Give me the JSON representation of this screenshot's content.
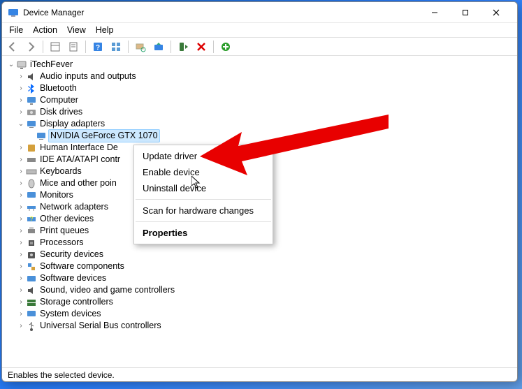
{
  "window": {
    "title": "Device Manager"
  },
  "menu": {
    "file": "File",
    "action": "Action",
    "view": "View",
    "help": "Help"
  },
  "tree": {
    "root": "iTechFever",
    "items": {
      "audio": "Audio inputs and outputs",
      "bluetooth": "Bluetooth",
      "computer": "Computer",
      "disk": "Disk drives",
      "display": "Display adapters",
      "display_child": "NVIDIA GeForce GTX 1070",
      "hid": "Human Interface De",
      "ide": "IDE ATA/ATAPI contr",
      "keyboards": "Keyboards",
      "mice": "Mice and other poin",
      "monitors": "Monitors",
      "network": "Network adapters",
      "other": "Other devices",
      "printq": "Print queues",
      "cpu": "Processors",
      "secdev": "Security devices",
      "swcomp": "Software components",
      "swdev": "Software devices",
      "sound": "Sound, video and game controllers",
      "storage": "Storage controllers",
      "sysdev": "System devices",
      "usb": "Universal Serial Bus controllers"
    }
  },
  "context": {
    "update": "Update driver",
    "enable": "Enable device",
    "uninstall": "Uninstall device",
    "scan": "Scan for hardware changes",
    "properties": "Properties"
  },
  "status": {
    "text": "Enables the selected device."
  }
}
